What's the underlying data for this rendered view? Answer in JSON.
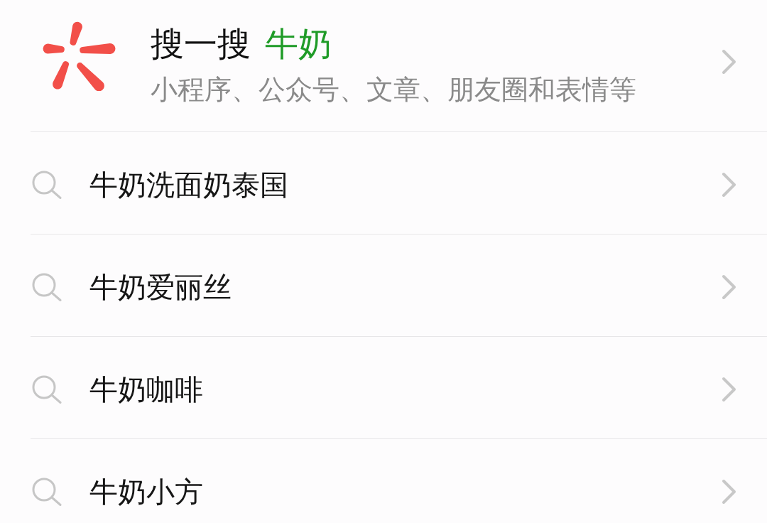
{
  "search_entry": {
    "label": "搜一搜",
    "query": "牛奶",
    "description": "小程序、公众号、文章、朋友圈和表情等"
  },
  "suggestions": [
    {
      "text": "牛奶洗面奶泰国"
    },
    {
      "text": "牛奶爱丽丝"
    },
    {
      "text": "牛奶咖啡"
    },
    {
      "text": "牛奶小方"
    }
  ]
}
